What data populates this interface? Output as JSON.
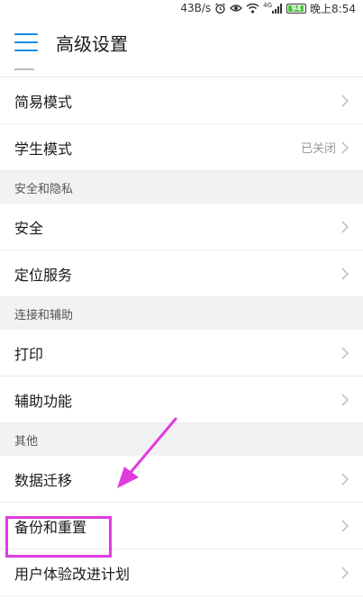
{
  "status_bar": {
    "speed": "43B/s",
    "signal": "4G",
    "battery": "94",
    "time": "晚上8:54",
    "icons": [
      "alarm-icon",
      "eye-icon",
      "wifi-icon",
      "signal-icon",
      "battery-icon"
    ]
  },
  "app_bar": {
    "title": "高级设置",
    "menu_icon": "hamburger-menu-icon",
    "accent_color": "#1a8be0"
  },
  "list": {
    "simple_mode": {
      "label": "简易模式"
    },
    "student_mode": {
      "label": "学生模式",
      "value": "已关闭"
    },
    "section_security": {
      "title": "安全和隐私"
    },
    "security": {
      "label": "安全"
    },
    "location": {
      "label": "定位服务"
    },
    "section_connect": {
      "title": "连接和辅助"
    },
    "print": {
      "label": "打印"
    },
    "accessibility": {
      "label": "辅助功能"
    },
    "section_other": {
      "title": "其他"
    },
    "data_migration": {
      "label": "数据迁移"
    },
    "backup_reset": {
      "label": "备份和重置"
    },
    "user_experience": {
      "label": "用户体验改进计划"
    }
  },
  "annotation": {
    "highlight_color": "#e03be0"
  }
}
